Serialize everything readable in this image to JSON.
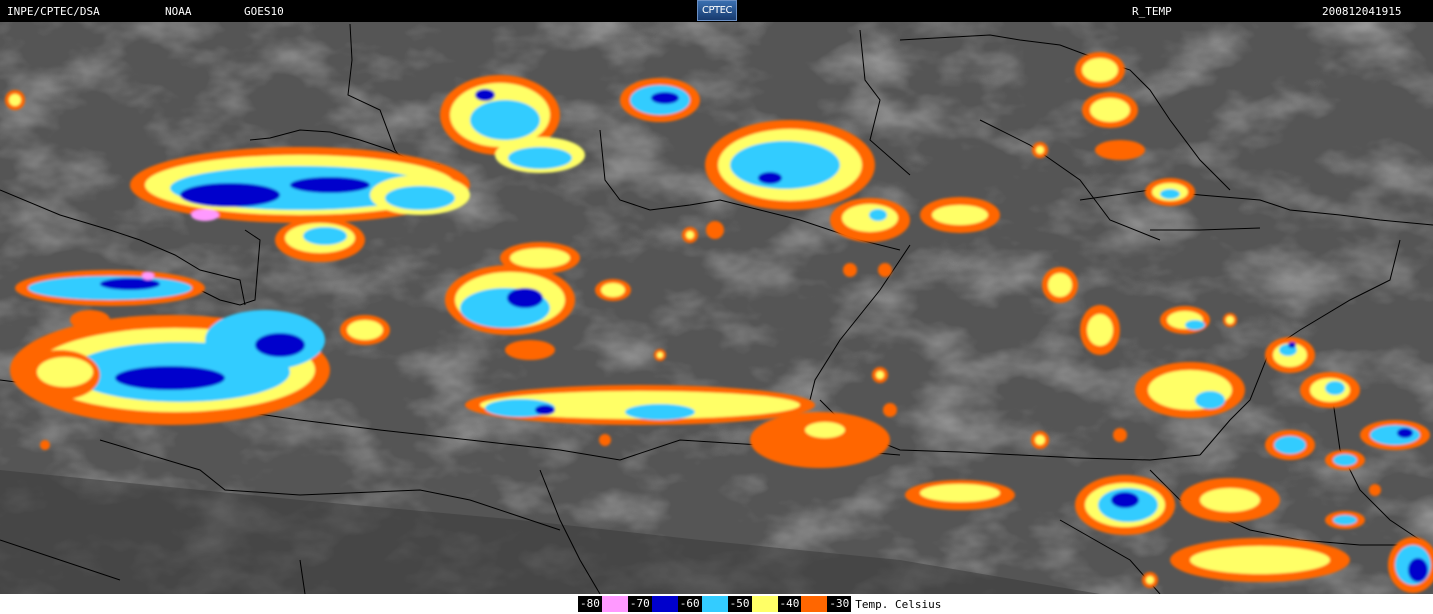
{
  "header": {
    "source": "INPE/CPTEC/DSA",
    "agency": "NOAA",
    "satellite": "GOES10",
    "logo_text": "CPTEC",
    "product": "R_TEMP",
    "timestamp": "200812041915"
  },
  "legend": {
    "items": [
      {
        "label": "-80",
        "color": "#ff99ff"
      },
      {
        "label": "-70",
        "color": "#0000cc"
      },
      {
        "label": "-60",
        "color": "#33ccff"
      },
      {
        "label": "-50",
        "color": "#ffff66"
      },
      {
        "label": "-40",
        "color": "#ff6600"
      },
      {
        "label": "-30",
        "color": ""
      }
    ],
    "unit": "Temp. Celsius"
  }
}
